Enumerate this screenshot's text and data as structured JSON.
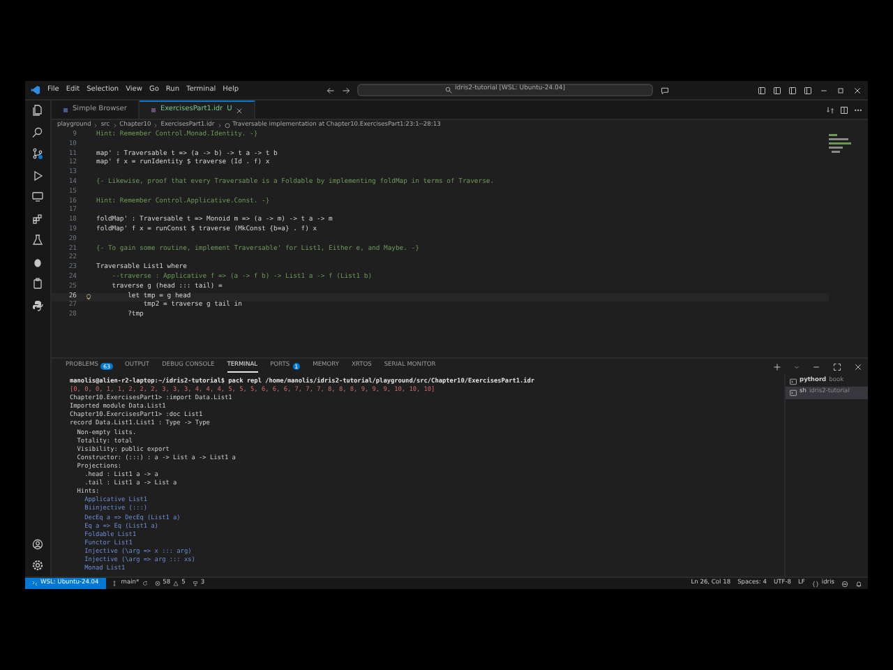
{
  "title_bar": {
    "menus": [
      "File",
      "Edit",
      "Selection",
      "View",
      "Go",
      "Run",
      "Terminal",
      "Help"
    ],
    "search": "idris2-tutorial [WSL: Ubuntu-24.04]"
  },
  "tabs": [
    {
      "label": "Simple Browser",
      "selected": false
    },
    {
      "label": "ExercisesPart1.idr",
      "status": "U",
      "selected": true
    }
  ],
  "breadcrumb": [
    "playground",
    "src",
    "Chapter10",
    "ExercisesPart1.idr",
    "Traversable implementation at Chapter10.ExercisesPart1:23:1--28:13"
  ],
  "editor": {
    "lines": [
      {
        "number": "9",
        "text": "Hint: Remember Control.Monad.Identity. -}",
        "kind": "comment",
        "current": false
      },
      {
        "number": "10",
        "current": false
      },
      {
        "number": "11",
        "text": "map' : Traversable t => (a -> b) -> t a -> t b",
        "kind": "code",
        "current": false
      },
      {
        "number": "12",
        "text": "map' f x = runIdentity $ traverse (Id . f) x",
        "kind": "code",
        "current": false
      },
      {
        "number": "13",
        "current": false
      },
      {
        "number": "14",
        "text": "{- Likewise, proof that every Traversable is a Foldable by implementing foldMap in terms of Traverse.",
        "kind": "comment",
        "current": false
      },
      {
        "number": "15",
        "current": false
      },
      {
        "number": "16",
        "text": "Hint: Remember Control.Applicative.Const. -}",
        "kind": "comment",
        "current": false
      },
      {
        "number": "17",
        "current": false
      },
      {
        "number": "18",
        "text": "foldMap' : Traversable t => Monoid m => (a -> m) -> t a -> m",
        "kind": "code",
        "current": false
      },
      {
        "number": "19",
        "text": "foldMap' f x = runConst $ traverse (MkConst {b=a} . f) x",
        "kind": "code",
        "current": false
      },
      {
        "number": "20",
        "current": false
      },
      {
        "number": "21",
        "text": "{- To gain some routine, implement Traversable' for List1, Either e, and Maybe. -}",
        "kind": "comment",
        "current": false
      },
      {
        "number": "22",
        "current": false
      },
      {
        "number": "23",
        "text": "Traversable List1 where",
        "kind": "code",
        "current": false
      },
      {
        "number": "24",
        "text": "    --traverse : Applicative f => (a -> f b) -> List1 a -> f (List1 b)",
        "kind": "comment",
        "current": false
      },
      {
        "number": "25",
        "text": "    traverse g (head ::: tail) =",
        "kind": "code",
        "current": false
      },
      {
        "number": "26",
        "text": "        let tmp = g head",
        "kind": "code",
        "current": true
      },
      {
        "number": "27",
        "text": "            tmp2 = traverse g tail in",
        "kind": "code",
        "current": false
      },
      {
        "number": "28",
        "text": "        ?tmp",
        "kind": "code",
        "current": false
      }
    ]
  },
  "panel": {
    "tabs": [
      {
        "label": "PROBLEMS",
        "badge": "63",
        "selected": false
      },
      {
        "label": "OUTPUT",
        "selected": false
      },
      {
        "label": "DEBUG CONSOLE",
        "selected": false
      },
      {
        "label": "TERMINAL",
        "selected": true
      },
      {
        "label": "PORTS",
        "badge": "1",
        "selected": false
      },
      {
        "label": "MEMORY",
        "selected": false
      },
      {
        "label": "XRTOS",
        "selected": false
      },
      {
        "label": "SERIAL MONITOR",
        "selected": false
      }
    ],
    "terminal_lines": [
      {
        "text": "manolis@alien-r2-laptop:~/idris2-tutorial$ pack repl /home/manolis/idris2-tutorial/playground/src/Chapter10/ExercisesPart1.idr",
        "kind": "prompt"
      },
      {
        "text": "[0, 0, 0, 1, 1, 2, 2, 2, 3, 3, 3, 4, 4, 4, 5, 5, 5, 6, 6, 6, 7, 7, 7, 8, 8, 8, 9, 9, 9, 10, 10, 10]",
        "kind": "value"
      },
      {
        "text": "Chapter10.ExercisesPart1> :import Data.List1",
        "kind": "plain"
      },
      {
        "text": "Imported module Data.List1",
        "kind": "plain"
      },
      {
        "text": "Chapter10.ExercisesPart1> :doc List1",
        "kind": "plain"
      },
      {
        "text": "record Data.List1.List1 : Type -> Type",
        "kind": "plain"
      },
      {
        "text": "  Non-empty lists.",
        "kind": "plain"
      },
      {
        "text": "  Totality: total",
        "kind": "plain"
      },
      {
        "text": "  Visibility: public export",
        "kind": "plain"
      },
      {
        "text": "  Constructor: (:::) : a -> List a -> List1 a",
        "kind": "plain"
      },
      {
        "text": "  Projections:",
        "kind": "plain"
      },
      {
        "text": "    .head : List1 a -> a",
        "kind": "plain"
      },
      {
        "text": "    .tail : List1 a -> List a",
        "kind": "plain"
      },
      {
        "text": "  Hints:",
        "kind": "plain"
      },
      {
        "text": "    Applicative List1",
        "kind": "hint"
      },
      {
        "text": "    Biinjective (:::)",
        "kind": "hint"
      },
      {
        "text": "    DecEq a => DecEq (List1 a)",
        "kind": "hint"
      },
      {
        "text": "    Eq a => Eq (List1 a)",
        "kind": "hint"
      },
      {
        "text": "    Foldable List1",
        "kind": "hint"
      },
      {
        "text": "    Functor List1",
        "kind": "hint"
      },
      {
        "text": "    Injective (\\arg => x ::: arg)",
        "kind": "hint"
      },
      {
        "text": "    Injective (\\arg => arg ::: xs)",
        "kind": "hint"
      },
      {
        "text": "    Monad List1",
        "kind": "hint"
      }
    ],
    "terminals": [
      {
        "name": "pythord",
        "detail": "book",
        "selected": false
      },
      {
        "name": "sh",
        "detail": "idris2-tutorial",
        "selected": true
      }
    ]
  },
  "status_bar": {
    "remote": "WSL: Ubuntu-24.04",
    "branch": "main*",
    "errors": "58",
    "warnings": "5",
    "ports": "3",
    "position": "Ln 26, Col 18",
    "indent": "Spaces: 4",
    "encoding": "UTF-8",
    "eol": "LF",
    "language": "idris"
  }
}
